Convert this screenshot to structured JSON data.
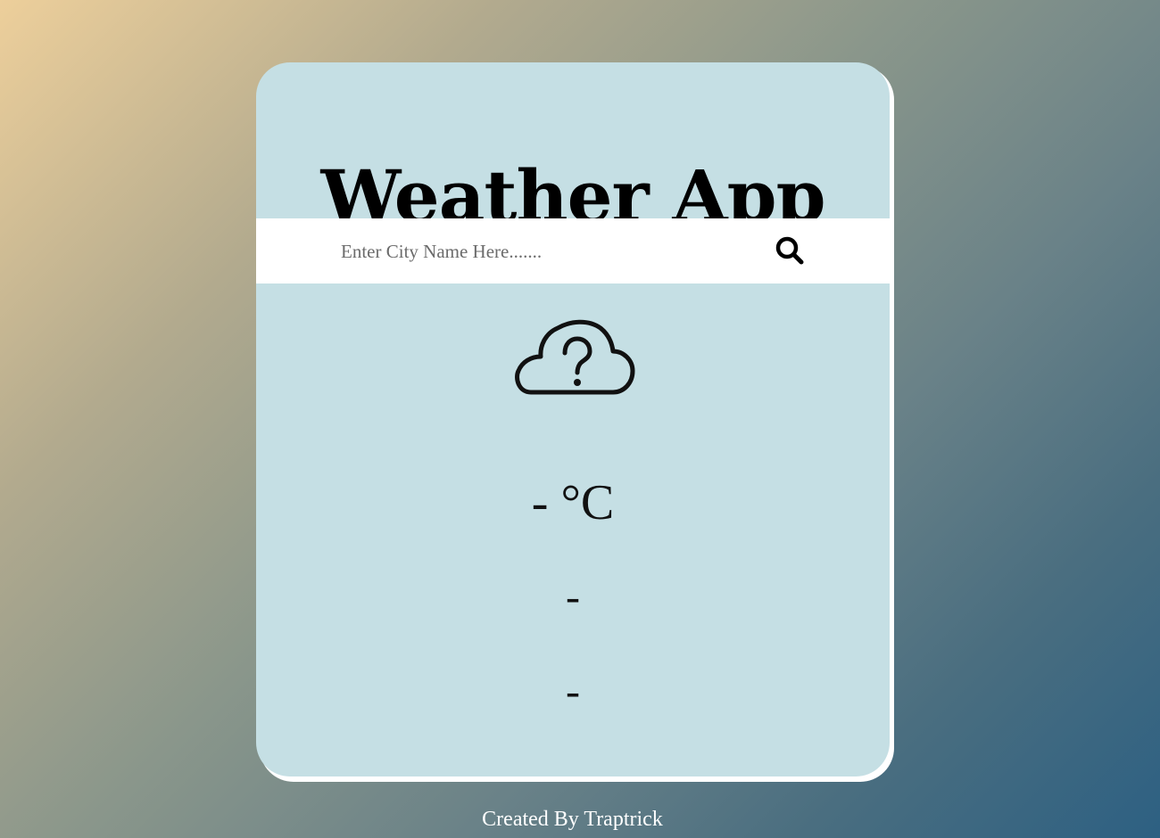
{
  "app": {
    "title": "Weather App"
  },
  "search": {
    "placeholder": "Enter City Name Here.......",
    "value": "",
    "button_icon": "search-icon"
  },
  "weather": {
    "icon": "cloud-question-icon",
    "temperature": "- °C",
    "description": "-",
    "location": "-"
  },
  "footer": {
    "credit": "Created By Traptrick"
  },
  "colors": {
    "card_background": "#c5dfe4",
    "search_background": "#ffffff",
    "text": "#000000",
    "footer_text": "#ffffff"
  }
}
